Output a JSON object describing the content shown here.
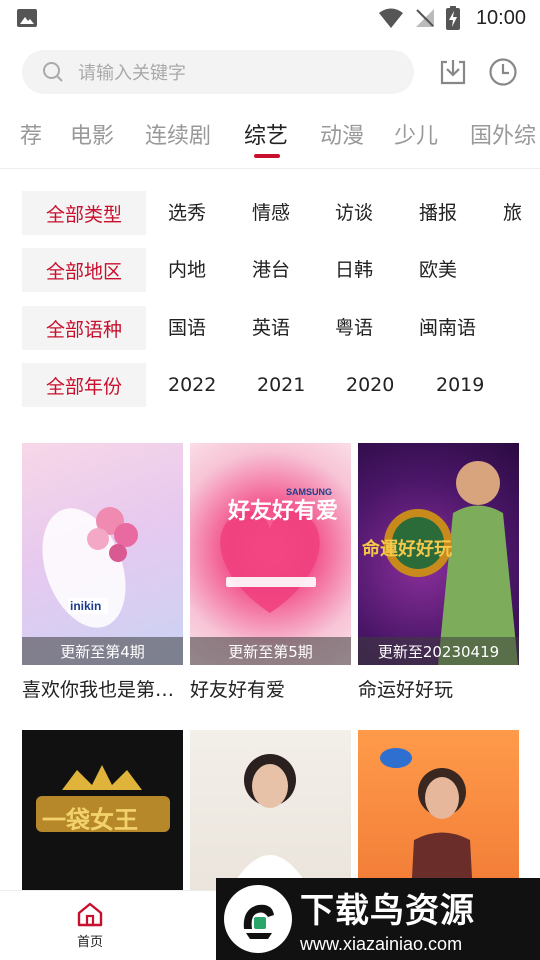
{
  "status_bar": {
    "time": "10:00",
    "icons": [
      "gallery-icon",
      "wifi-icon",
      "no-signal-icon",
      "battery-charging-icon"
    ]
  },
  "search": {
    "placeholder": "请输入关键字",
    "icons": [
      "search-icon",
      "download-icon",
      "history-clock-icon"
    ]
  },
  "tabs": [
    {
      "label": "荐",
      "active": false
    },
    {
      "label": "电影",
      "active": false
    },
    {
      "label": "连续剧",
      "active": false
    },
    {
      "label": "综艺",
      "active": true
    },
    {
      "label": "动漫",
      "active": false
    },
    {
      "label": "少儿",
      "active": false
    },
    {
      "label": "国外综",
      "active": false
    }
  ],
  "filters": [
    {
      "selected": "全部类型",
      "options": [
        "选秀",
        "情感",
        "访谈",
        "播报",
        "旅"
      ]
    },
    {
      "selected": "全部地区",
      "options": [
        "内地",
        "港台",
        "日韩",
        "欧美"
      ]
    },
    {
      "selected": "全部语种",
      "options": [
        "国语",
        "英语",
        "粤语",
        "闽南语"
      ]
    },
    {
      "selected": "全部年份",
      "options": [
        "2022",
        "2021",
        "2020",
        "2019"
      ]
    }
  ],
  "shows": [
    {
      "title": "喜欢你我也是第…",
      "update": "更新至第4期"
    },
    {
      "title": "好友好有爱",
      "update": "更新至第5期"
    },
    {
      "title": "命运好好玩",
      "update": "更新至20230419"
    },
    {
      "title": "",
      "update": ""
    },
    {
      "title": "",
      "update": ""
    },
    {
      "title": "",
      "update": ""
    }
  ],
  "poster_text": {
    "p1_brand": "inikin",
    "p2_title": "好友好有爱",
    "p2_brand": "SAMSUNG",
    "p3_title": "命運好好玩",
    "p4_title": "一袋女王"
  },
  "bottom_nav": {
    "home_label": "首页"
  },
  "watermark": {
    "name": "下载鸟资源",
    "url": "www.xiazainiao.com"
  },
  "colors": {
    "accent": "#c8102e",
    "text": "#222222",
    "muted": "#999999",
    "search_bg": "#f3f3f3"
  }
}
